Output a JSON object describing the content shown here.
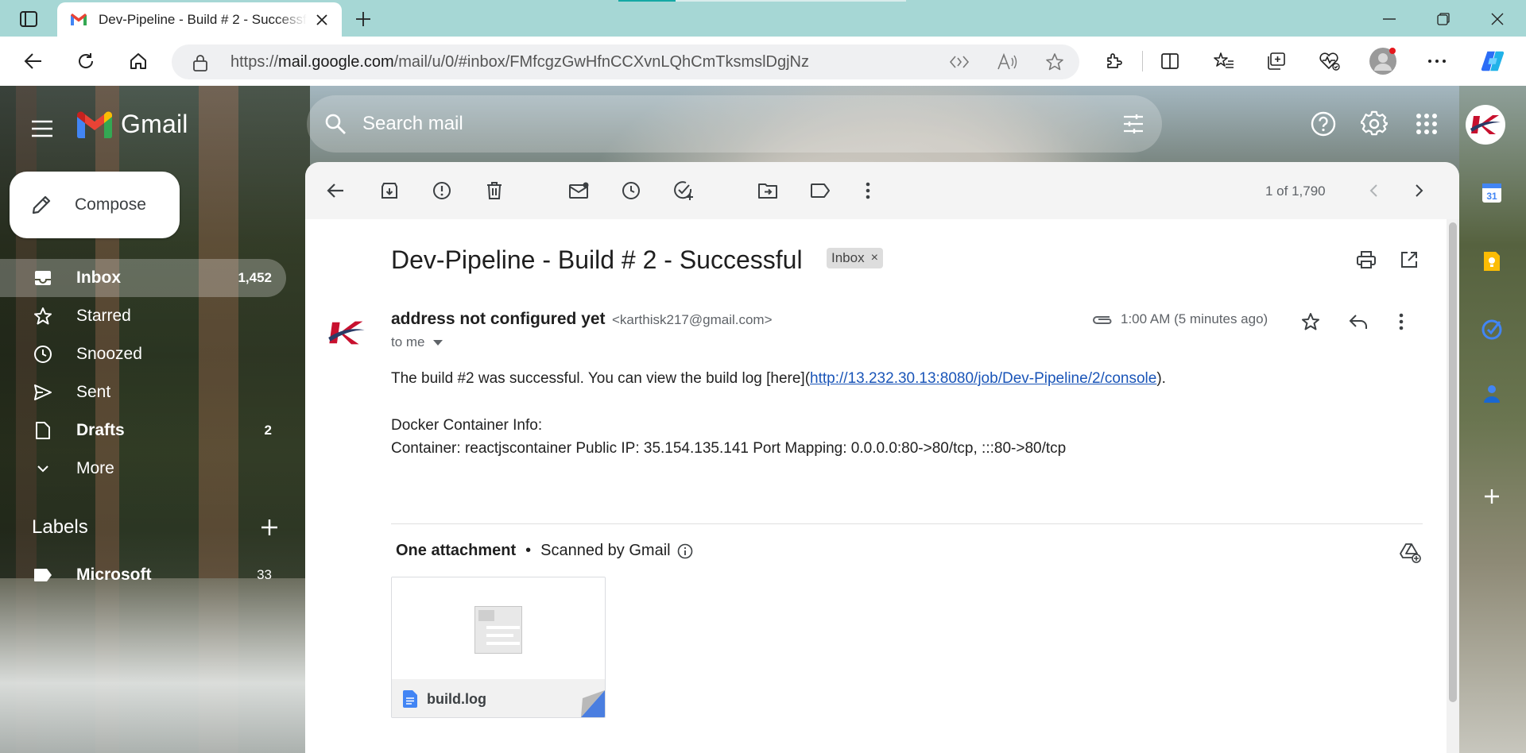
{
  "browser": {
    "tab_title": "Dev-Pipeline - Build # 2 - Successful",
    "url_prefix": "https://",
    "url_host": "mail.google.com",
    "url_path": "/mail/u/0/#inbox/FMfcgzGwHfnCCXvnLQhCmTksmslDgjNz"
  },
  "gmail": {
    "logo_text": "Gmail",
    "search_placeholder": "Search mail",
    "compose_label": "Compose",
    "nav": [
      {
        "label": "Inbox",
        "count": "1,452"
      },
      {
        "label": "Starred",
        "count": ""
      },
      {
        "label": "Snoozed",
        "count": ""
      },
      {
        "label": "Sent",
        "count": ""
      },
      {
        "label": "Drafts",
        "count": "2"
      },
      {
        "label": "More",
        "count": ""
      }
    ],
    "labels_heading": "Labels",
    "labels": [
      {
        "label": "Microsoft",
        "count": "33"
      }
    ],
    "pager": "1 of 1,790"
  },
  "message": {
    "subject": "Dev-Pipeline - Build # 2 - Successful",
    "chip": "Inbox",
    "sender_name": "address not configured yet",
    "sender_email": "<karthisk217@gmail.com>",
    "to": "to me",
    "time": "1:00 AM (5 minutes ago)",
    "body_line1_before": "The build #2 was successful. You can view the build log [here](",
    "body_link": "http://13.232.30.13:8080/job/Dev-Pipeline/2/console",
    "body_line1_after": ").",
    "body_line2": "Docker Container Info:",
    "body_line3": "Container: reactjscontainer Public IP: 35.154.135.141 Port Mapping: 0.0.0.0:80->80/tcp, :::80->80/tcp"
  },
  "attachments": {
    "heading": "One attachment",
    "scanned": "Scanned by Gmail",
    "file_name": "build.log"
  },
  "colors": {
    "gmail_red": "#ea4335",
    "gmail_blue": "#4285f4",
    "gmail_green": "#34a853",
    "gmail_yellow": "#fbbc04",
    "link": "#1a55b8",
    "titlebar": "#a6d7d5"
  }
}
